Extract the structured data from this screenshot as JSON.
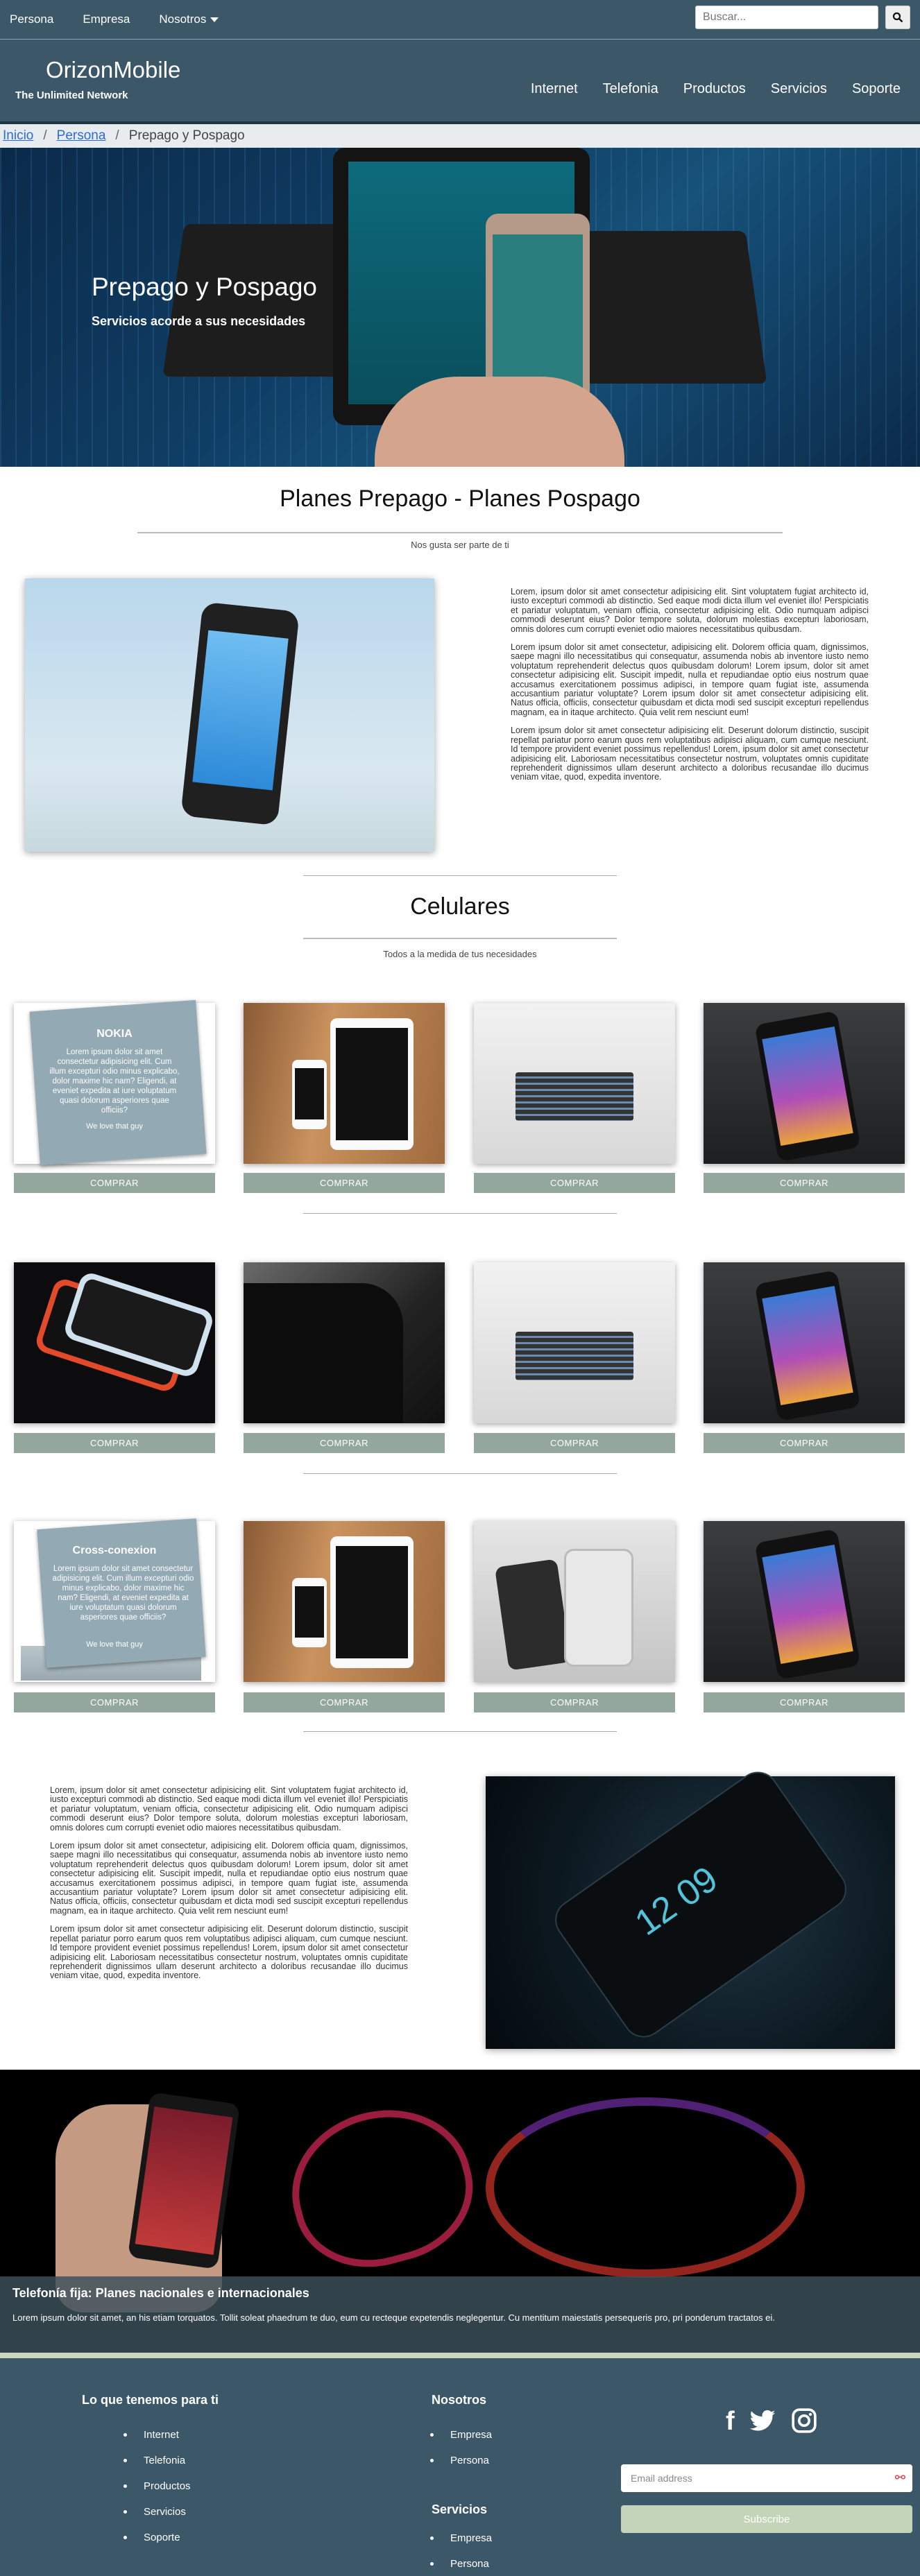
{
  "topbar": {
    "links": [
      "Persona",
      "Empresa",
      "Nosotros"
    ],
    "search_placeholder": "Buscar..."
  },
  "header": {
    "brand": "OrizonMobile",
    "tagline": "The Unlimited Network",
    "nav": [
      "Internet",
      "Telefonia",
      "Productos",
      "Servicios",
      "Soporte"
    ]
  },
  "breadcrumb": {
    "home": "Inicio",
    "section": "Persona",
    "current": "Prepago y Pospago"
  },
  "hero": {
    "title": "Prepago y Pospago",
    "subtitle": "Servicios acorde a sus necesidades"
  },
  "plans": {
    "title": "Planes Prepago - Planes Pospago",
    "subtitle": "Nos gusta ser parte de ti",
    "paragraphs": [
      "Lorem, ipsum dolor sit amet consectetur adipisicing elit. Sint voluptatem fugiat architecto id, iusto excepturi commodi ab distinctio. Sed eaque modi dicta illum vel eveniet illo! Perspiciatis et pariatur voluptatum, veniam officia, consectetur adipisicing elit. Odio numquam adipisci commodi deserunt eius? Dolor tempore soluta, dolorum molestias excepturi laboriosam, omnis dolores cum corrupti eveniet odio maiores necessitatibus quibusdam.",
      "Lorem ipsum dolor sit amet consectetur, adipisicing elit. Dolorem officia quam, dignissimos, saepe magni illo necessitatibus qui consequatur, assumenda nobis ab inventore iusto nemo voluptatum reprehenderit delectus quos quibusdam dolorum! Lorem ipsum, dolor sit amet consectetur adipisicing elit. Suscipit impedit, nulla et repudiandae optio eius nostrum quae accusamus exercitationem possimus adipisci, in tempore quam fugiat iste, assumenda accusantium pariatur voluptate? Lorem ipsum dolor sit amet consectetur adipisicing elit. Natus officia, officiis, consectetur quibusdam et dicta modi sed suscipit excepturi repellendus magnam, ea in itaque architecto. Quia velit rem nesciunt eum!",
      "Lorem ipsum dolor sit amet consectetur adipisicing elit. Deserunt dolorum distinctio, suscipit repellat pariatur porro earum quos rem voluptatibus adipisci aliquam, cum cumque nesciunt. Id tempore provident eveniet possimus repellendus! Lorem, ipsum dolor sit amet consectetur adipisicing elit. Laboriosam necessitatibus consectetur nostrum, voluptates omnis cupiditate reprehenderit dignissimos ullam deserunt architecto a doloribus recusandae illo ducimus veniam vitae, quod, expedita inventore."
    ]
  },
  "celulares": {
    "title": "Celulares",
    "subtitle": "Todos a la medida de tus necesidades",
    "buy_label": "COMPRAR",
    "card_nokia": {
      "title": "NOKIA",
      "desc": "Lorem ipsum dolor sit amet consectetur adipisicing elit. Cum illum excepturi odio minus explicabo, dolor maxime hic nam? Eligendi, at eveniet expedita at iure voluptatum quasi dolorum asperiores quae officiis?",
      "quote": "We love that guy"
    },
    "card_cross": {
      "title": "Cross-conexion",
      "desc": "Lorem ipsum dolor sit amet consectetur adipisicing elit. Cum illum excepturi odio minus explicabo, dolor maxime hic nam? Eligendi, at eveniet expedita at iure voluptatum quasi dolorum asperiores quae officiis?",
      "quote": "We love that guy"
    },
    "lockscreen_time": "12 09"
  },
  "banner": {
    "title": "Telefonía fija: Planes nacionales e internacionales",
    "text": "Lorem ipsum dolor sit amet, an his etiam torquatos. Tollit soleat phaedrum te duo, eum cu recteque expetendis neglegentur. Cu mentitum maiestatis persequeris pro, pri ponderum tractatos ei."
  },
  "footer": {
    "col1_title": "Lo que tenemos para ti",
    "col1_items": [
      "Internet",
      "Telefonia",
      "Productos",
      "Servicios",
      "Soporte"
    ],
    "col2_title": "Nosotros",
    "col2_items": [
      "Empresa",
      "Persona"
    ],
    "col3_title": "Servicios",
    "col3_items": [
      "Empresa",
      "Persona"
    ],
    "email_placeholder": "Email address",
    "subscribe_label": "Subscribe",
    "social_icons": [
      "facebook-icon",
      "twitter-icon",
      "instagram-icon"
    ]
  },
  "colors": {
    "header_bg": "#3b5768",
    "button_bg": "#94a79c",
    "subscribe_bg": "#c4d4b8"
  }
}
